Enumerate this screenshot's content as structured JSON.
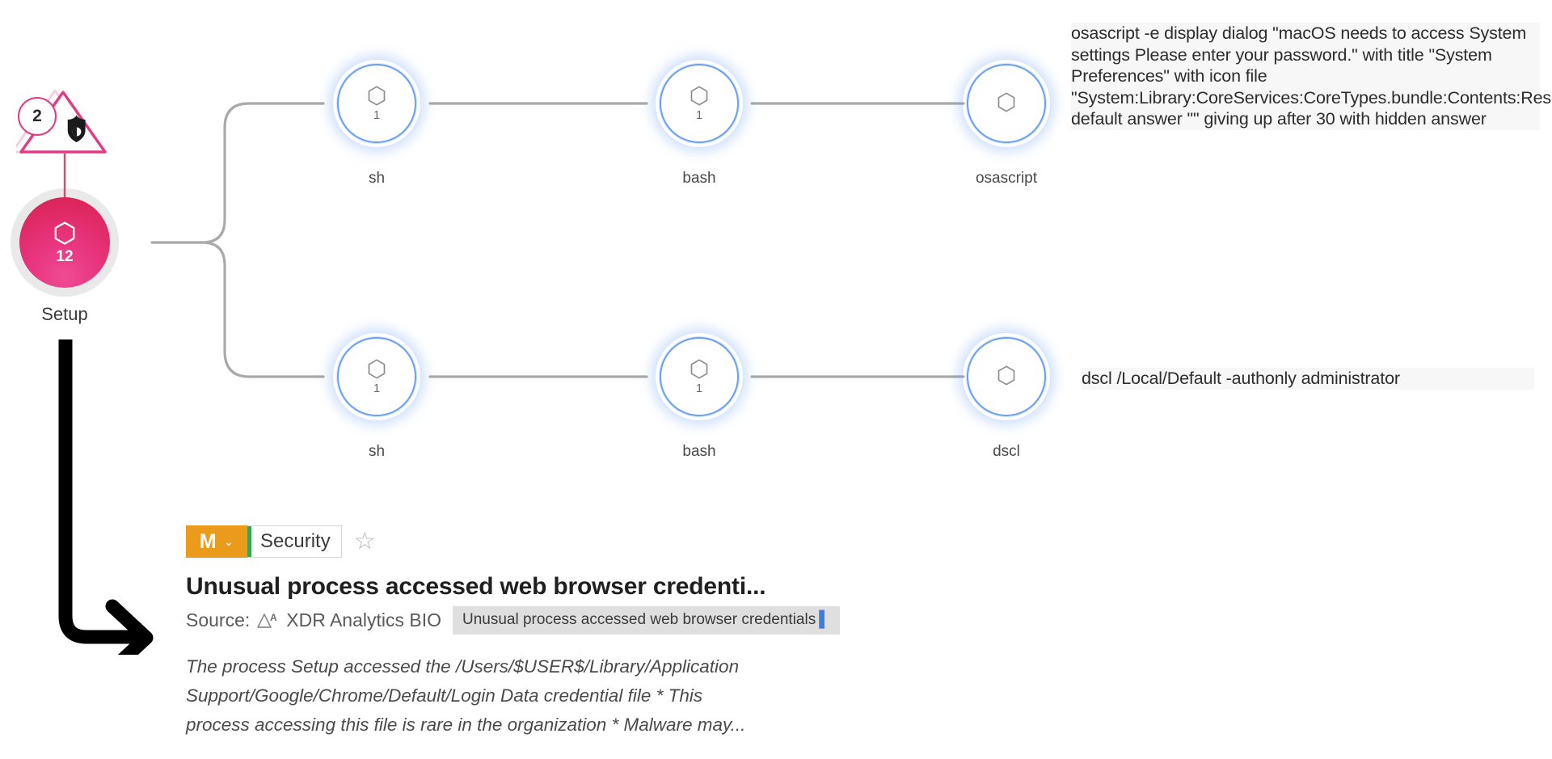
{
  "graph": {
    "root": {
      "label": "Setup",
      "count": "12",
      "icon": "hexagon-process-icon",
      "color": "#d8204f",
      "alert_badge": {
        "count": "2",
        "icon": "shield-alert-triangle-icon",
        "color": "#e03b84"
      }
    },
    "branches": [
      {
        "name": "osascript-branch",
        "nodes": [
          {
            "label": "sh",
            "count": "1",
            "icon": "hexagon-process-icon"
          },
          {
            "label": "bash",
            "count": "1",
            "icon": "hexagon-process-icon"
          },
          {
            "label": "osascript",
            "count": "",
            "icon": "hexagon-process-icon"
          }
        ],
        "command_lines": [
          "osascript -e display dialog \"macOS needs to access",
          "System settings Please enter your password.\" with title",
          "\"System Preferences\" with icon file",
          "\"System:Library:CoreServices:CoreTypes.bundle:Conte",
          "nts:Resources:ToolbarAdvanced.icns\" default answer \"\"",
          "giving up after 30 with hidden answer"
        ],
        "command_text": "osascript -e display dialog \"macOS needs to access System settings Please enter your password.\" with title \"System Preferences\" with icon file \"System:Library:CoreServices:CoreTypes.bundle:Contents:Resources:ToolbarAdvanced.icns\" default answer \"\" giving up after 30 with hidden answer"
      },
      {
        "name": "dscl-branch",
        "nodes": [
          {
            "label": "sh",
            "count": "1",
            "icon": "hexagon-process-icon"
          },
          {
            "label": "bash",
            "count": "1",
            "icon": "hexagon-process-icon"
          },
          {
            "label": "dscl",
            "count": "",
            "icon": "hexagon-process-icon"
          }
        ],
        "command_lines": [
          "dscl /Local/Default -authonly administrator"
        ],
        "command_text": "dscl /Local/Default -authonly administrator"
      }
    ]
  },
  "alert_card": {
    "severity_letter": "M",
    "severity_chevron": "⌄",
    "severity_color": "#eb9b1c",
    "category": "Security",
    "category_accent": "#35a853",
    "star_icon": "star-outline-icon",
    "title": "Unusual process accessed web browser credenti...",
    "source_label": "Source:",
    "source_icon": "xdr-analytics-icon",
    "source_value": "XDR Analytics BIO",
    "tooltip_text": "Unusual process accessed web browser credentials",
    "tooltip_caret": "▌",
    "description": "The process Setup accessed the /Users/$USER$/Library/Application Support/Google/Chrome/Default/Login Data credential file * This process accessing this file is rare in the organization * Malware may..."
  },
  "annotation": {
    "arrow_icon": "bent-down-right-arrow-icon"
  }
}
